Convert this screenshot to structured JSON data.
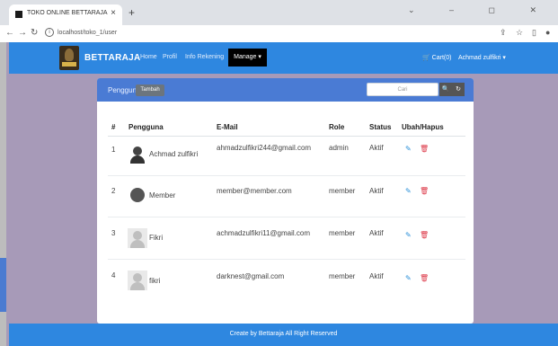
{
  "browser": {
    "tab_title": "TOKO ONLINE BETTARAJA",
    "tab_close": "×",
    "new_tab": "+",
    "url": "localhost/toko_1/user",
    "window_controls": "⌄ – ◻ ✕"
  },
  "header": {
    "brand": "BETTARAJA",
    "menu": [
      "Home",
      "Profil",
      "Info Rekening"
    ],
    "manage": "Manage ▾",
    "cart": "🛒 Cart(0)",
    "user": "Achmad zulfikri ▾"
  },
  "card": {
    "title": "Pengguna",
    "add_button": "Tambah",
    "search_placeholder": "Cari",
    "search_icon": "🔍",
    "refresh_icon": "↻"
  },
  "table": {
    "headers": [
      "#",
      "Pengguna",
      "E-Mail",
      "Role",
      "Status",
      "Ubah/Hapus"
    ],
    "rows": [
      {
        "no": "1",
        "name": "Achmad zulfikri",
        "email": "ahmadzulfikri244@gmail.com",
        "role": "admin",
        "status": "Aktif"
      },
      {
        "no": "2",
        "name": "Member",
        "email": "member@member.com",
        "role": "member",
        "status": "Aktif"
      },
      {
        "no": "3",
        "name": "Fikri",
        "email": "achmadzulfikri11@gmail.com",
        "role": "member",
        "status": "Aktif"
      },
      {
        "no": "4",
        "name": "fikri",
        "email": "darknest@gmail.com",
        "role": "member",
        "status": "Aktif"
      }
    ],
    "edit_icon": "✎",
    "delete_icon": "🗑"
  },
  "footer": {
    "text": "Create by Bettaraja All Right Reserved"
  },
  "colors": {
    "primary": "#2e87e0",
    "card_header": "#4a7bd4",
    "background": "#a79ab8"
  }
}
